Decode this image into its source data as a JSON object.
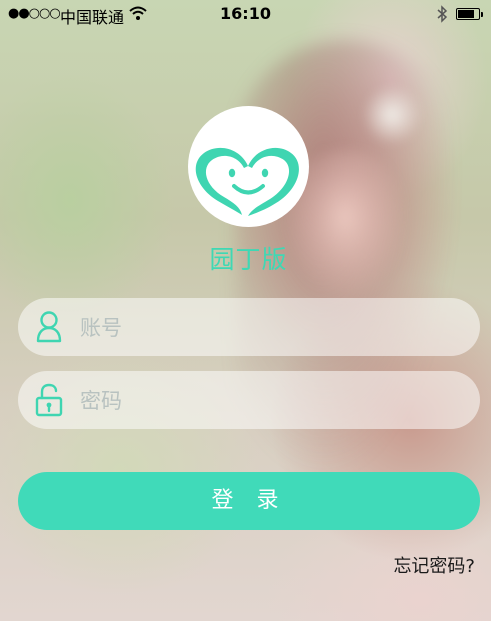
{
  "status_bar": {
    "signal_dots": "●●○○○",
    "carrier": "中国联通",
    "time": "16:10"
  },
  "app": {
    "name": "园丁版"
  },
  "login_form": {
    "account_placeholder": "账号",
    "password_placeholder": "密码",
    "login_label": "登 录",
    "forgot_password_label": "忘记密码?"
  },
  "colors": {
    "accent": "#40dab9",
    "logo_background": "#ffffff"
  },
  "icons": {
    "logo": "heart-smile-icon",
    "account": "user-icon",
    "password": "unlock-icon",
    "wifi": "wifi-icon",
    "bluetooth": "bluetooth-icon",
    "battery": "battery-icon"
  }
}
